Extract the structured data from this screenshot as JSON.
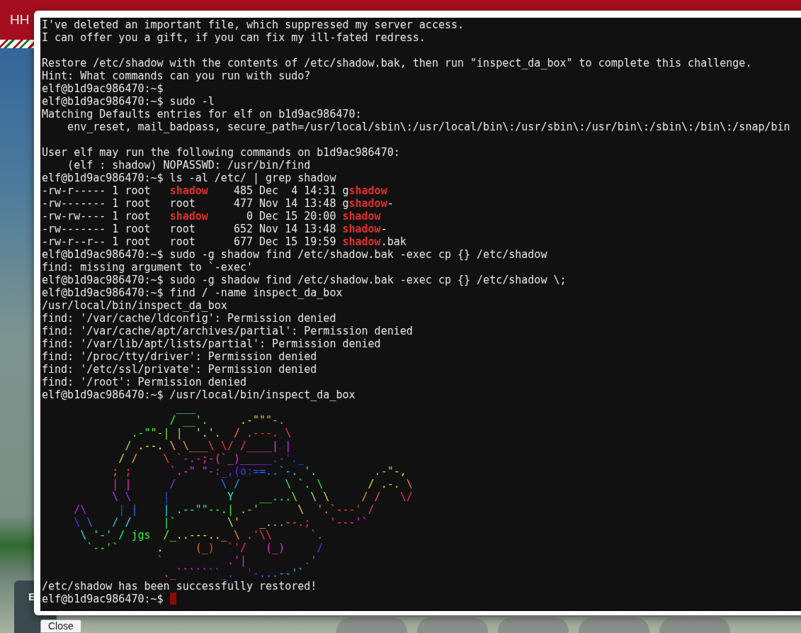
{
  "header": {
    "title": "HH"
  },
  "side_panel": {
    "label": "E"
  },
  "terminal": {
    "lines": [
      {
        "kind": "text",
        "cursor": false,
        "text": "I've deleted an important file, which suppressed my server access."
      },
      {
        "kind": "text",
        "cursor": false,
        "text": "I can offer you a gift, if you can fix my ill-fated redress."
      },
      {
        "kind": "blank"
      },
      {
        "kind": "text",
        "cursor": false,
        "text": "Restore /etc/shadow with the contents of /etc/shadow.bak, then run \"inspect_da_box\" to complete this challenge."
      },
      {
        "kind": "text",
        "cursor": false,
        "text": "Hint: What commands can you run with sudo?"
      },
      {
        "kind": "text",
        "cursor": false,
        "text": "elf@b1d9ac986470:~$"
      },
      {
        "kind": "text",
        "cursor": false,
        "text": "elf@b1d9ac986470:~$ sudo -l"
      },
      {
        "kind": "text",
        "cursor": false,
        "text": "Matching Defaults entries for elf on b1d9ac986470:"
      },
      {
        "kind": "text",
        "cursor": false,
        "text": "    env_reset, mail_badpass, secure_path=/usr/local/sbin\\:/usr/local/bin\\:/usr/sbin\\:/usr/bin\\:/sbin\\:/bin\\:/snap/bin"
      },
      {
        "kind": "blank"
      },
      {
        "kind": "text",
        "cursor": false,
        "text": "User elf may run the following commands on b1d9ac986470:"
      },
      {
        "kind": "text",
        "cursor": false,
        "text": "    (elf : shadow) NOPASSWD: /usr/bin/find"
      },
      {
        "kind": "text",
        "cursor": false,
        "text": "elf@b1d9ac986470:~$ ls -al /etc/ | grep shadow"
      },
      {
        "kind": "text",
        "cursor": false,
        "text": "-rw-r----- 1 root   **shadow**    485 Dec  4 14:31 g**shadow**"
      },
      {
        "kind": "text",
        "cursor": false,
        "text": "-rw------- 1 root   root      477 Nov 14 13:48 g**shadow**-"
      },
      {
        "kind": "text",
        "cursor": false,
        "text": "-rw-rw---- 1 root   **shadow**      0 Dec 15 20:00 **shadow**"
      },
      {
        "kind": "text",
        "cursor": false,
        "text": "-rw------- 1 root   root      652 Nov 14 13:48 **shadow**-"
      },
      {
        "kind": "text",
        "cursor": false,
        "text": "-rw-r--r-- 1 root   root      677 Dec 15 19:59 **shadow**.bak"
      },
      {
        "kind": "text",
        "cursor": false,
        "text": "elf@b1d9ac986470:~$ sudo -g shadow find /etc/shadow.bak -exec cp {} /etc/shadow"
      },
      {
        "kind": "text",
        "cursor": false,
        "text": "find: missing argument to `-exec'"
      },
      {
        "kind": "text",
        "cursor": false,
        "text": "elf@b1d9ac986470:~$ sudo -g shadow find /etc/shadow.bak -exec cp {} /etc/shadow \\;"
      },
      {
        "kind": "text",
        "cursor": false,
        "text": "elf@b1d9ac986470:~$ find / -name inspect_da_box"
      },
      {
        "kind": "text",
        "cursor": false,
        "text": "/usr/local/bin/inspect_da_box"
      },
      {
        "kind": "text",
        "cursor": false,
        "text": "find: '/var/cache/ldconfig': Permission denied"
      },
      {
        "kind": "text",
        "cursor": false,
        "text": "find: '/var/cache/apt/archives/partial': Permission denied"
      },
      {
        "kind": "text",
        "cursor": false,
        "text": "find: '/var/lib/apt/lists/partial': Permission denied"
      },
      {
        "kind": "text",
        "cursor": false,
        "text": "find: '/proc/tty/driver': Permission denied"
      },
      {
        "kind": "text",
        "cursor": false,
        "text": "find: '/etc/ssl/private': Permission denied"
      },
      {
        "kind": "text",
        "cursor": false,
        "text": "find: '/root': Permission denied"
      },
      {
        "kind": "text",
        "cursor": false,
        "text": "elf@b1d9ac986470:~$ /usr/local/bin/inspect_da_box"
      },
      {
        "kind": "art",
        "text": "                     ___"
      },
      {
        "kind": "art",
        "text": "                    / __'.     .-\"\"\"-."
      },
      {
        "kind": "art",
        "text": "              .-\"\"-| |  '.'.  / .---. \\"
      },
      {
        "kind": "art",
        "text": "             / .--. \\ \\___\\ \\/ /____| |"
      },
      {
        "kind": "art",
        "text": "            / /    \\ `-.-;-(`_)_____.-'._"
      },
      {
        "kind": "art",
        "text": "           ; ;      `.-\" \"-:_,(o:==..`-. '.         .-\"-,"
      },
      {
        "kind": "art",
        "text": "           | |      /       \\ /       \\ `. \\       / .-. \\"
      },
      {
        "kind": "art",
        "text": "           \\ \\     |         Y    __...\\  \\ \\     / /   \\/"
      },
      {
        "kind": "art",
        "text": "     /\\     | |    | .--\"\"--.| .-'      \\  '.`---' /"
      },
      {
        "kind": "art",
        "text": "     \\ \\   / /     |`        \\'   _...--.;   '---'`"
      },
      {
        "kind": "art",
        "text": "      \\ '-' / jgs  /_..---.._ \\ .'\\\\      `."
      },
      {
        "kind": "art",
        "text": "       `--'`      .     (_)  `'/   (_)     /"
      },
      {
        "kind": "art",
        "text": "                  `          .'|         .'"
      },
      {
        "kind": "art",
        "text": "                   ._```````_.  '-...--'`"
      },
      {
        "kind": "text",
        "cursor": false,
        "text": "/etc/shadow has been successfully restored!"
      },
      {
        "kind": "text",
        "cursor": true,
        "text": "elf@b1d9ac986470:~$"
      }
    ]
  },
  "close_button": {
    "label": "Close"
  }
}
